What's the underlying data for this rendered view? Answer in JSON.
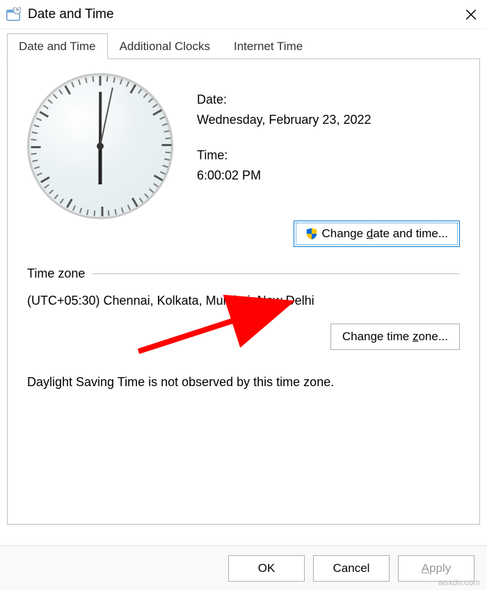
{
  "window": {
    "title": "Date and Time"
  },
  "tabs": [
    {
      "label": "Date and Time",
      "active": true
    },
    {
      "label": "Additional Clocks",
      "active": false
    },
    {
      "label": "Internet Time",
      "active": false
    }
  ],
  "dateSection": {
    "dateLabel": "Date:",
    "dateValue": "Wednesday, February 23, 2022",
    "timeLabel": "Time:",
    "timeValue": "6:00:02 PM",
    "clock": {
      "hour": 18,
      "minute": 0,
      "second": 2
    }
  },
  "buttons": {
    "changeDateTime": {
      "prefix": "Change ",
      "accel": "d",
      "suffix": "ate and time..."
    },
    "changeTimeZone": {
      "prefix": "Change time ",
      "accel": "z",
      "suffix": "one..."
    }
  },
  "timezone": {
    "legend": "Time zone",
    "value": "(UTC+05:30) Chennai, Kolkata, Mumbai, New Delhi"
  },
  "dstNote": "Daylight Saving Time is not observed by this time zone.",
  "footer": {
    "ok": "OK",
    "cancel": "Cancel",
    "apply": {
      "accel": "A",
      "suffix": "pply"
    }
  },
  "watermark": "wsxdn.com"
}
